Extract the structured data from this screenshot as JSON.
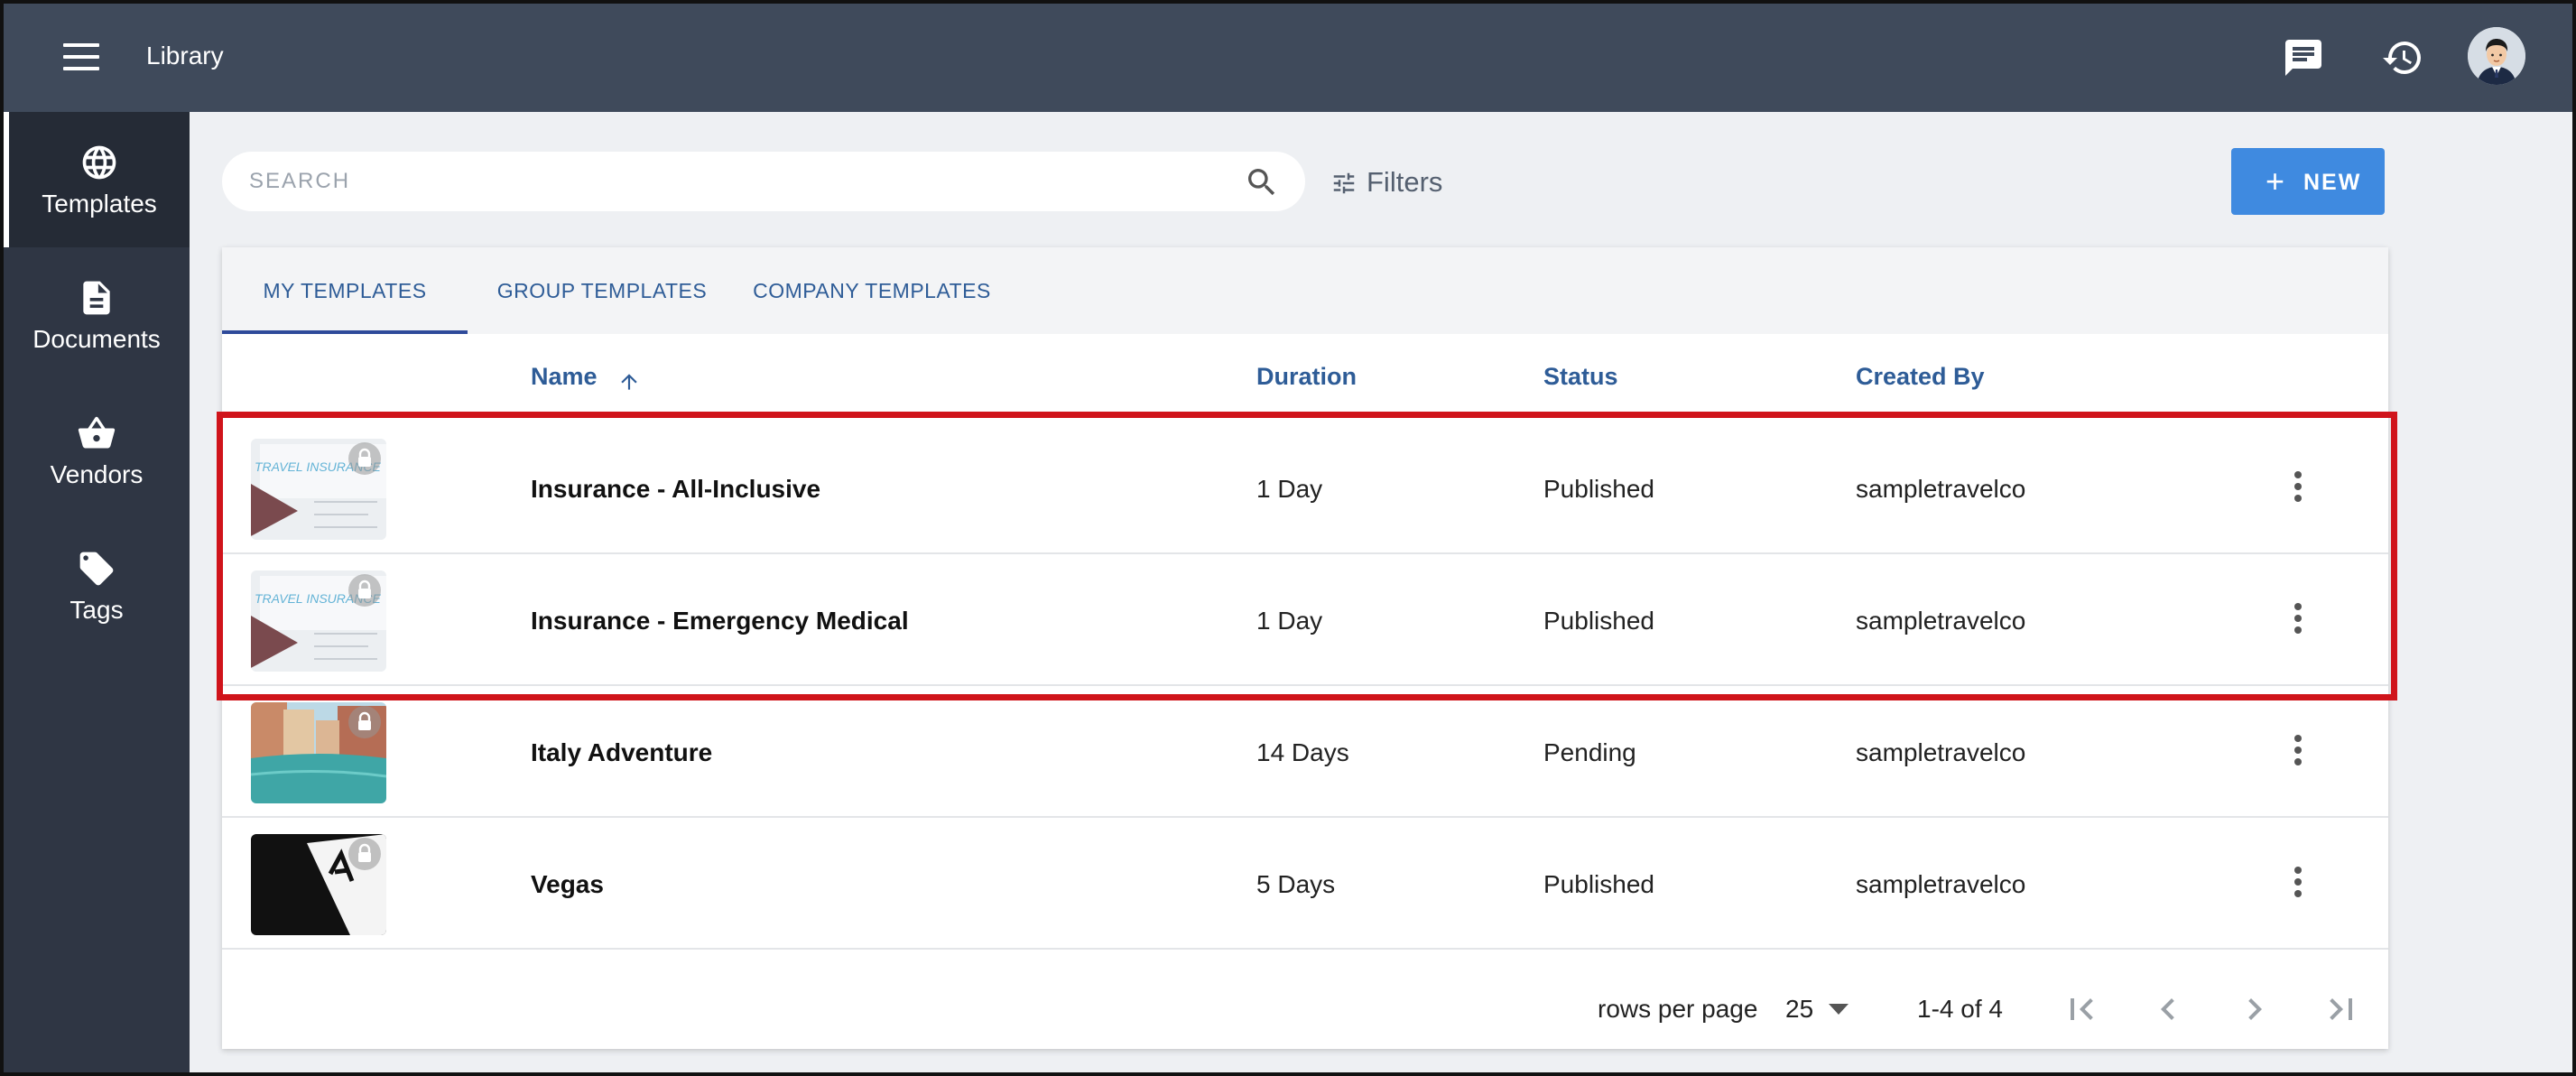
{
  "app": {
    "title": "Library"
  },
  "topbar": {
    "icons": [
      "chat-icon",
      "history-icon"
    ],
    "avatar": "avatar"
  },
  "sidebar": {
    "items": [
      {
        "label": "Templates",
        "icon": "globe-icon",
        "active": true
      },
      {
        "label": "Documents",
        "icon": "document-icon",
        "active": false
      },
      {
        "label": "Vendors",
        "icon": "basket-icon",
        "active": false
      },
      {
        "label": "Tags",
        "icon": "tag-icon",
        "active": false
      }
    ]
  },
  "toolbar": {
    "search_placeholder": "SEARCH",
    "filters_label": "Filters",
    "new_label": "NEW"
  },
  "tabs": [
    {
      "label": "MY TEMPLATES",
      "active": true
    },
    {
      "label": "GROUP TEMPLATES",
      "active": false
    },
    {
      "label": "COMPANY TEMPLATES",
      "active": false
    }
  ],
  "table": {
    "columns": {
      "name": "Name",
      "duration": "Duration",
      "status": "Status",
      "created_by": "Created By"
    },
    "rows": [
      {
        "name": "Insurance - All-Inclusive",
        "duration": "1 Day",
        "status": "Published",
        "created_by": "sampletravelco",
        "thumb": "travel-insurance",
        "locked": true,
        "highlighted": true
      },
      {
        "name": "Insurance - Emergency Medical",
        "duration": "1 Day",
        "status": "Published",
        "created_by": "sampletravelco",
        "thumb": "travel-insurance",
        "locked": true,
        "highlighted": true
      },
      {
        "name": "Italy Adventure",
        "duration": "14 Days",
        "status": "Pending",
        "created_by": "sampletravelco",
        "thumb": "venice-canal",
        "locked": true,
        "highlighted": false
      },
      {
        "name": "Vegas",
        "duration": "5 Days",
        "status": "Published",
        "created_by": "sampletravelco",
        "thumb": "playing-card",
        "locked": true,
        "highlighted": false
      }
    ]
  },
  "pagination": {
    "rows_per_page_label": "rows per page",
    "rows_per_page_value": "25",
    "range": "1-4 of 4"
  },
  "colors": {
    "topbar": "#3f4a5b",
    "sidebar": "#2f3644",
    "accent": "#3f8ae0",
    "header_text": "#2e5c97",
    "highlight": "#d0141b"
  }
}
